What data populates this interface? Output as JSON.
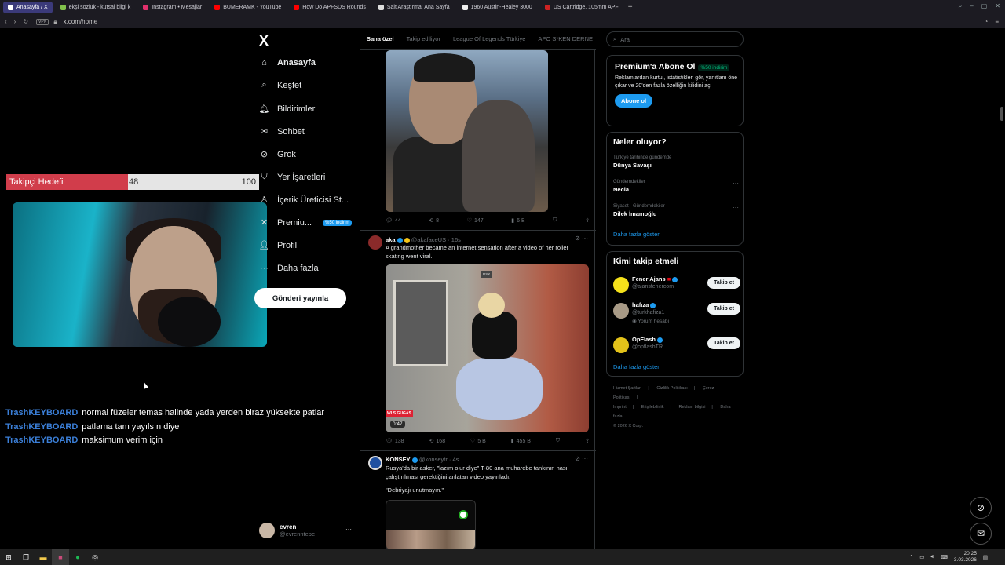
{
  "browser": {
    "tabs": [
      {
        "label": "Anasayfa / X",
        "active": true,
        "color": "#ffffff"
      },
      {
        "label": "ekşi sözlük - kutsal bilgi k",
        "active": false,
        "color": "#81c14b"
      },
      {
        "label": "Instagram • Mesajlar",
        "active": false,
        "color": "#e1306c"
      },
      {
        "label": "BUMERAMK - YouTube",
        "active": false,
        "color": "#ff0000"
      },
      {
        "label": "How Do APFSDS Rounds",
        "active": false,
        "color": "#ff0000"
      },
      {
        "label": "Salt Araştırma: Ana Sayfa",
        "active": false,
        "color": "#dddddd"
      },
      {
        "label": "1960 Austin-Healey 3000",
        "active": false,
        "color": "#eeeeee"
      },
      {
        "label": "US Cartridge, 105mm APF",
        "active": false,
        "color": "#cc2222"
      }
    ],
    "new_tab": "+",
    "url": "x.com/home",
    "vpn": "VPN"
  },
  "overlay": {
    "goal_label": "Takipçi Hedefi",
    "goal_current": "48",
    "goal_max": "100",
    "goal_fraction": 0.48,
    "chat": [
      {
        "user": "TrashKEYBOARD",
        "msg": "normal füzeler temas halinde yada yerden biraz yüksekte patlar"
      },
      {
        "user": "TrashKEYBOARD",
        "msg": "patlama tam yayılsın diye"
      },
      {
        "user": "TrashKEYBOARD",
        "msg": "maksimum verim için"
      }
    ]
  },
  "nav": {
    "logo": "X",
    "items": [
      {
        "label": "Anasayfa",
        "icon": "home-icon",
        "glyph": "⌂"
      },
      {
        "label": "Keşfet",
        "icon": "search-icon",
        "glyph": "⌕"
      },
      {
        "label": "Bildirimler",
        "icon": "bell-icon",
        "glyph": "🔔︎"
      },
      {
        "label": "Sohbet",
        "icon": "mail-icon",
        "glyph": "✉"
      },
      {
        "label": "Grok",
        "icon": "grok-icon",
        "glyph": "⊘"
      },
      {
        "label": "Yer İşaretleri",
        "icon": "bookmark-icon",
        "glyph": "⛉"
      },
      {
        "label": "İçerik Üreticisi St...",
        "icon": "creator-icon",
        "glyph": "♙"
      },
      {
        "label": "Premiu...",
        "icon": "premium-icon",
        "glyph": "✕",
        "badge": "%50 indirim"
      },
      {
        "label": "Profil",
        "icon": "profile-icon",
        "glyph": "👤︎"
      },
      {
        "label": "Daha fazla",
        "icon": "more-icon",
        "glyph": "⋯"
      }
    ],
    "post_button": "Gönderi yayınla",
    "account": {
      "name": "evren",
      "handle": "@evrenntepe",
      "more": "···"
    }
  },
  "timeline": {
    "tabs": [
      "Sana özel",
      "Takip ediliyor",
      "League Of Legends Türkiye",
      "APO S*KEN DERNE"
    ],
    "posts": [
      {
        "stats": {
          "replies": "44",
          "reposts": "8",
          "likes": "147",
          "views": "6 B"
        }
      },
      {
        "name": "aka",
        "handle": "@akafaceUS",
        "time": "16s",
        "text": "A grandmother became an internet sensation after a video of her roller skating went viral.",
        "media_duration": "0:47",
        "media_tag": "WLS GUGAS",
        "media_corner": "RSX",
        "stats": {
          "replies": "138",
          "reposts": "168",
          "likes": "5 B",
          "views": "455 B"
        }
      },
      {
        "name": "KONSEY",
        "handle": "@konseytr",
        "time": "4s",
        "text": "Rusya'da bir asker, \"lazım olur diye\" T-80 ana muharebe tankının nasıl çalıştırılması gerektiğini anlatan video yayınladı:",
        "quote": "\"Debriyajı unutmayın.\""
      }
    ]
  },
  "sidebar": {
    "search_placeholder": "Ara",
    "premium": {
      "title": "Premium'a Abone Ol",
      "discount": "%50 indirim",
      "text": "Reklamlardan kurtul, istatistikleri gör, yanıtlanı öne çıkar ve 20'den fazla özelliğin kilidini aç.",
      "button": "Abone ol"
    },
    "trends": {
      "title": "Neler oluyor?",
      "items": [
        {
          "context": "Türkiye tarihinde gündemde",
          "topic": "Dünya Savaşı"
        },
        {
          "context": "Gündemdekiler",
          "topic": "Necla"
        },
        {
          "context": "Siyaset · Gündemdekiler",
          "topic": "Dilek İmamoğlu"
        }
      ],
      "more": "Daha fazla göster"
    },
    "follow": {
      "title": "Kimi takip etmeli",
      "items": [
        {
          "name": "Fener Ajans",
          "handle": "@ajansfenercom",
          "extra": "",
          "button": "Takip et",
          "color": "#f5e11b"
        },
        {
          "name": "hafıza",
          "handle": "@turkhafiza1",
          "extra": "Yorum hesabı",
          "button": "Takip et",
          "color": "#a89a86"
        },
        {
          "name": "OpFlash",
          "handle": "@opflashTR",
          "extra": "",
          "button": "Takip et",
          "color": "#e3c21a"
        }
      ],
      "more": "Daha fazla göster"
    },
    "legal": [
      "Hizmet Şartları",
      "Gizlilik Politikası",
      "Çerez Politikası",
      "Imprint",
      "Erişilebilirlik",
      "Reklam bilgisi",
      "Daha fazla ...",
      "© 2026 X Corp."
    ]
  },
  "taskbar": {
    "time": "20:25",
    "date": "3.03.2026"
  }
}
